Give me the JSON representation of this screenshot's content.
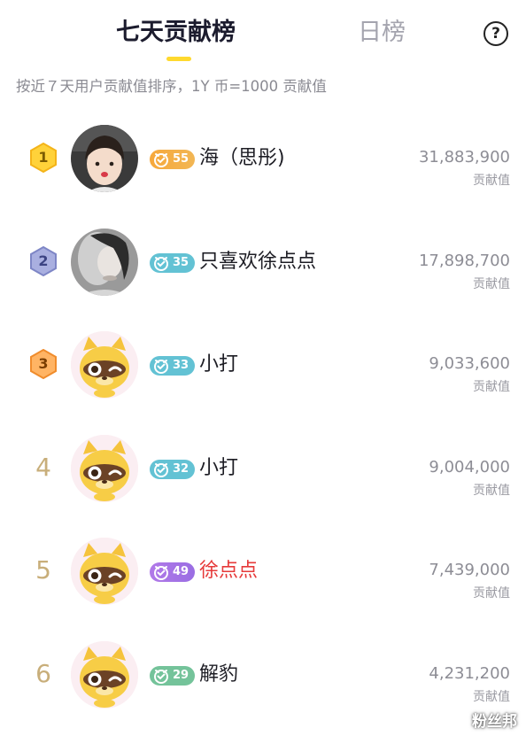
{
  "header": {
    "tab_active": "七天贡献榜",
    "tab_inactive": "日榜",
    "help_label": "?"
  },
  "subtitle": "按近７天用户贡献值排序，1Y 币=1000 贡献值",
  "colors": {
    "accent": "#ffd92e",
    "gold_badge": "#f2a338",
    "teal_badge": "#63c2d4",
    "purple_badge": "#a275e8",
    "green_badge": "#74c39a",
    "highlight_name": "#e63a3a",
    "rank_number": "#c8ae7a"
  },
  "rows": [
    {
      "rank": "1",
      "rank_style": "hex-gold",
      "avatar": "photo-boy",
      "level": "55",
      "badge_style": "orange",
      "name": "海（思彤)",
      "name_color": "#1d1d24",
      "score": "31,883,900",
      "score_unit": "贡献值"
    },
    {
      "rank": "2",
      "rank_style": "hex-silver",
      "avatar": "photo-smoke",
      "level": "35",
      "badge_style": "teal",
      "name": "只喜欢徐点点",
      "name_color": "#1d1d24",
      "score": "17,898,700",
      "score_unit": "贡献值"
    },
    {
      "rank": "3",
      "rank_style": "hex-bronze",
      "avatar": "raccoon",
      "level": "33",
      "badge_style": "teal",
      "name": "小打",
      "name_color": "#1d1d24",
      "score": "9,033,600",
      "score_unit": "贡献值"
    },
    {
      "rank": "4",
      "rank_style": "plain",
      "avatar": "raccoon",
      "level": "32",
      "badge_style": "teal",
      "name": "小打",
      "name_color": "#1d1d24",
      "score": "9,004,000",
      "score_unit": "贡献值"
    },
    {
      "rank": "5",
      "rank_style": "plain",
      "avatar": "raccoon",
      "level": "49",
      "badge_style": "purple",
      "name": "徐点点",
      "name_color": "#e63a3a",
      "score": "7,439,000",
      "score_unit": "贡献值"
    },
    {
      "rank": "6",
      "rank_style": "plain",
      "avatar": "raccoon",
      "level": "29",
      "badge_style": "green",
      "name": "解豹",
      "name_color": "#1d1d24",
      "score": "4,231,200",
      "score_unit": "贡献值"
    }
  ],
  "watermark": "粉丝邦"
}
